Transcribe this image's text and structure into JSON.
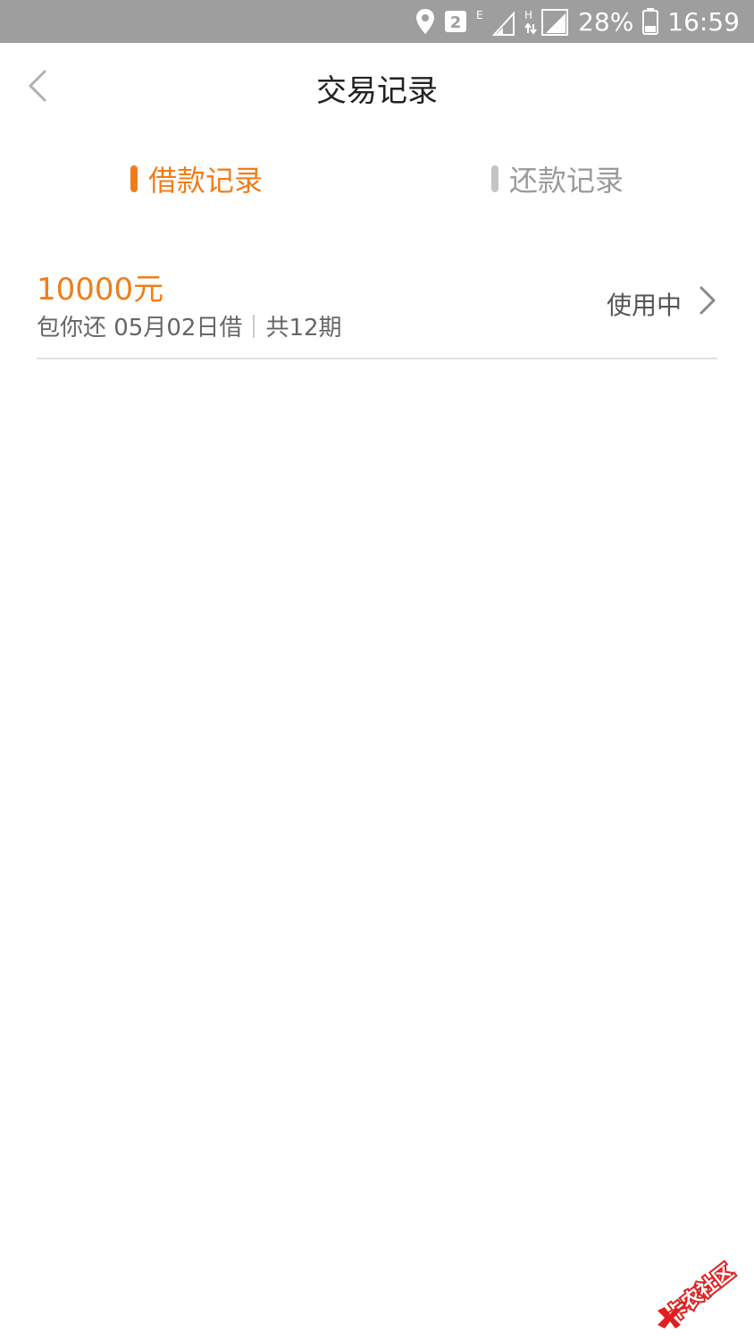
{
  "status_bar": {
    "sim_badge": "2",
    "network_e": "E",
    "network_h": "H",
    "battery_percent": "28%",
    "time": "16:59"
  },
  "header": {
    "title": "交易记录"
  },
  "tabs": [
    {
      "label": "借款记录",
      "active": true
    },
    {
      "label": "还款记录",
      "active": false
    }
  ],
  "records": [
    {
      "amount": "10000元",
      "product_date": "包你还 05月02日借",
      "installments": "共12期",
      "status": "使用中"
    }
  ],
  "watermark": {
    "text": "卡农社区"
  },
  "colors": {
    "accent": "#f07d1a",
    "status_bar_bg": "#9e9e9e",
    "inactive_tab": "#9a9a9a",
    "divider": "#e0e0e0"
  }
}
